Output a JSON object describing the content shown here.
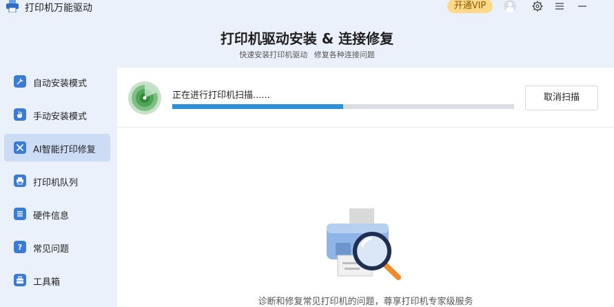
{
  "app": {
    "title": "打印机万能驱动",
    "vip_label": "开通VIP",
    "icons": [
      "printer-logo-icon",
      "avatar-icon",
      "gear-icon",
      "menu-icon",
      "minimize-icon"
    ]
  },
  "header": {
    "title": "打印机驱动安装 & 连接修复",
    "subtitle": "快速安装打印机驱动 修复各种连接问题"
  },
  "sidebar": {
    "items": [
      {
        "label": "自动安装模式",
        "icon": "wrench-icon",
        "active": false
      },
      {
        "label": "手动安装模式",
        "icon": "hand-icon",
        "active": false
      },
      {
        "label": "AI智能打印修复",
        "icon": "tools-icon",
        "active": true
      },
      {
        "label": "打印机队列",
        "icon": "printer-icon",
        "active": false
      },
      {
        "label": "硬件信息",
        "icon": "list-icon",
        "active": false
      },
      {
        "label": "常见问题",
        "icon": "question-icon",
        "active": false
      },
      {
        "label": "工具箱",
        "icon": "toolbox-icon",
        "active": false
      }
    ]
  },
  "scan": {
    "status_text": "正在进行打印机扫描......",
    "progress": 0.5,
    "cancel_label": "取消扫描"
  },
  "footer": {
    "text": "诊断和修复常见打印机的问题，尊享打印机专家级服务"
  },
  "colors": {
    "accent": "#3a7bd5",
    "progress": "#2f8fd8",
    "vip_bg": "#ffd98a",
    "active_nav": "#cddcf5",
    "background": "#eaf1fb"
  }
}
